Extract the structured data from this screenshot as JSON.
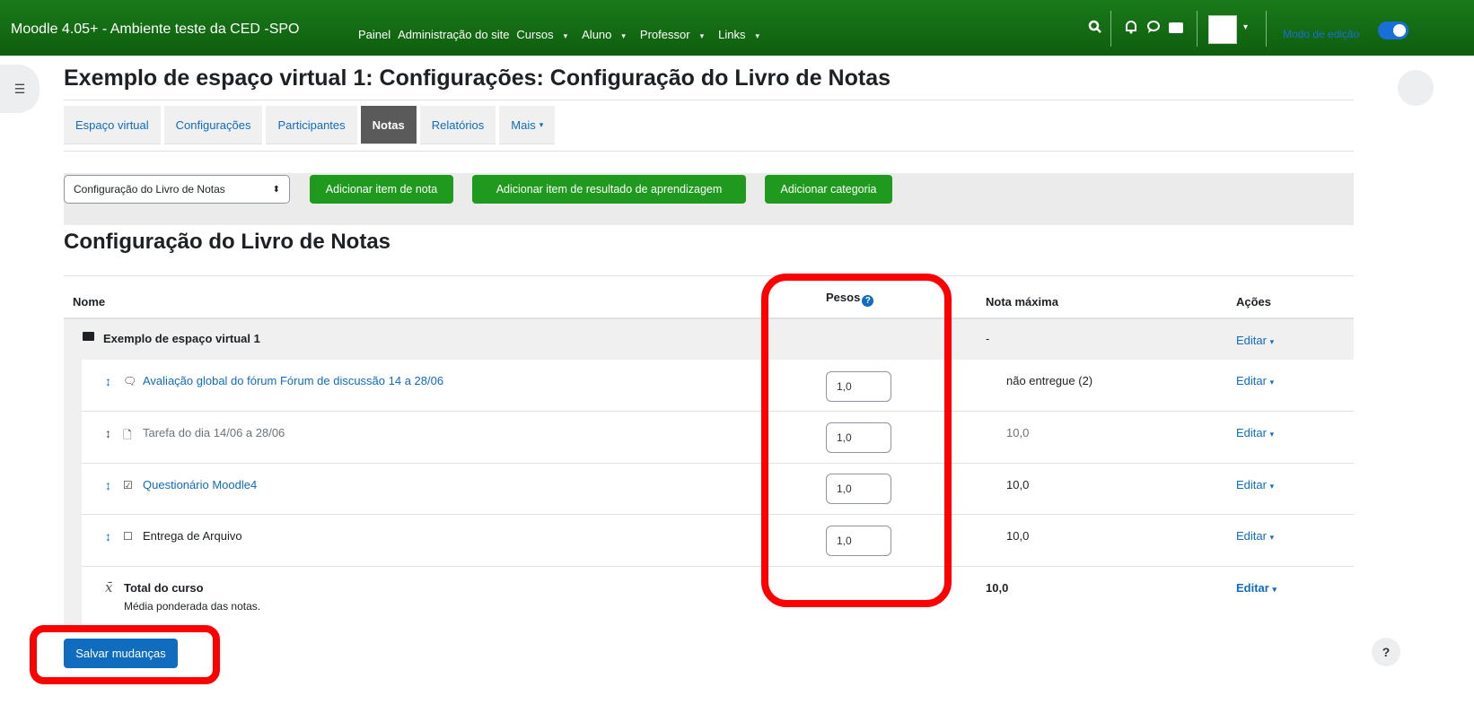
{
  "navbar": {
    "brand": "Moodle 4.05+ - Ambiente teste da CED -SPO",
    "links": [
      {
        "label": "Painel",
        "dropdown": false
      },
      {
        "label": "Administração do site",
        "dropdown": false
      },
      {
        "label": "Cursos",
        "dropdown": true
      },
      {
        "label": "Aluno",
        "dropdown": true
      },
      {
        "label": "Professor",
        "dropdown": true
      },
      {
        "label": "Links",
        "dropdown": true
      }
    ],
    "edit_mode_label": "Modo de edição",
    "icons": [
      "search-icon",
      "bell-icon",
      "chat-icon",
      "envelope-icon",
      "avatar",
      "chevron-down-icon"
    ]
  },
  "page_title": "Exemplo de espaço virtual 1: Configurações: Configuração do Livro de Notas",
  "tabs": [
    "Espaço virtual",
    "Configurações",
    "Participantes",
    "Notas",
    "Relatórios",
    "Mais"
  ],
  "active_tab": "Notas",
  "actionbar": {
    "select_value": "Configuração do Livro de Notas",
    "buttons": [
      "Adicionar item de nota",
      "Adicionar item de resultado de aprendizagem",
      "Adicionar categoria"
    ]
  },
  "section_title": "Configuração do Livro de Notas",
  "table": {
    "headers": {
      "name": "Nome",
      "weights": "Pesos",
      "max": "Nota máxima",
      "actions": "Ações"
    },
    "category": {
      "name": "Exemplo de espaço virtual 1",
      "max": "-",
      "edit": "Editar"
    },
    "items": [
      {
        "name": "Avaliação global do fórum Fórum de discussão 14 a 28/06",
        "icon": "forum-icon",
        "weight": "1,0",
        "max": "não entregue (2)",
        "edit": "Editar",
        "link": true
      },
      {
        "name": "Tarefa do dia 14/06 a 28/06",
        "icon": "assignment-icon",
        "weight": "1,0",
        "max": "10,0",
        "edit": "Editar",
        "link": false
      },
      {
        "name": "Questionário Moodle4",
        "icon": "quiz-icon",
        "weight": "1,0",
        "max": "10,0",
        "edit": "Editar",
        "link": true
      },
      {
        "name": "Entrega de Arquivo",
        "icon": "checkbox-icon",
        "weight": "1,0",
        "max": "10,0",
        "edit": "Editar",
        "link": false
      }
    ],
    "total": {
      "name": "Total do curso",
      "sub": "Média ponderada das notas.",
      "max": "10,0",
      "edit": "Editar"
    }
  },
  "save_button": "Salvar mudanças",
  "help_bubble": "?"
}
